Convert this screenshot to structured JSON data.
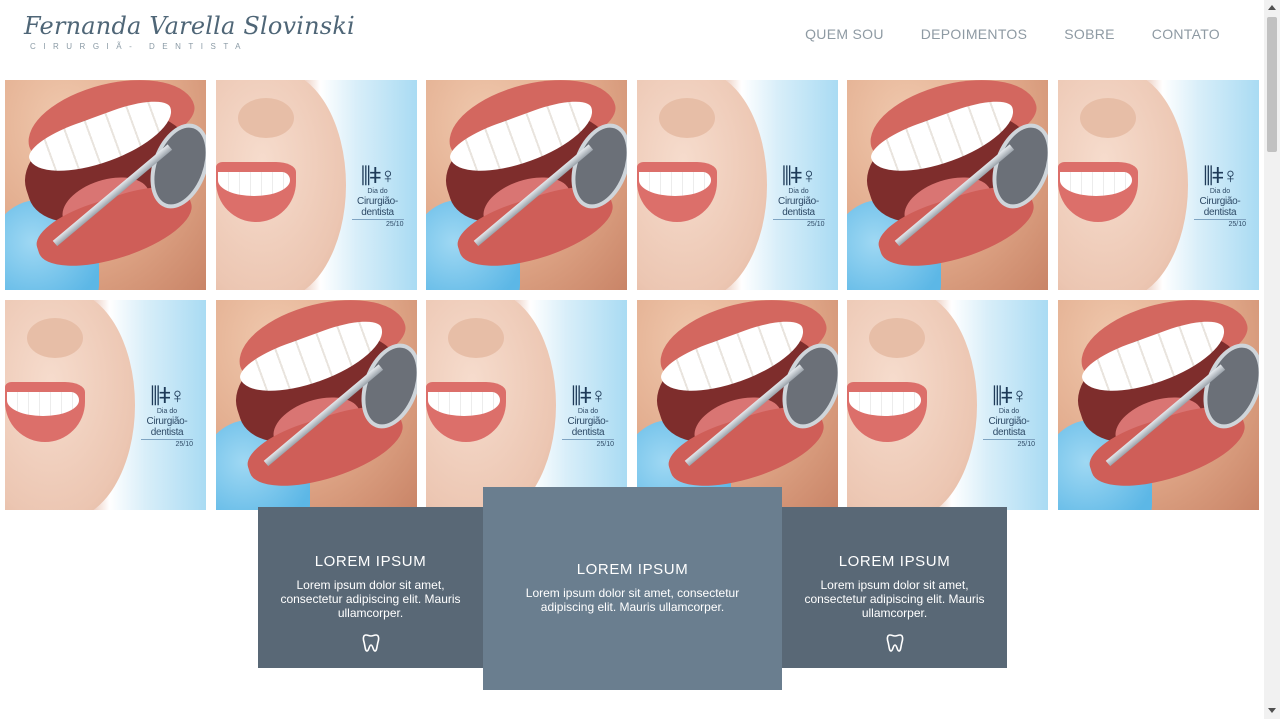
{
  "header": {
    "logo_name": "Fernanda Varella Slovinski",
    "logo_subtitle": "CIRURGIÃ- DENTISTA",
    "nav": [
      "QUEM SOU",
      "DEPOIMENTOS",
      "SOBRE",
      "CONTATO"
    ]
  },
  "gallery": {
    "badge": {
      "small": "Dia do",
      "main": "Cirurgião-dentista",
      "date": "25/10"
    },
    "rows": [
      [
        "mirror",
        "blue",
        "mirror",
        "blue",
        "mirror",
        "blue"
      ],
      [
        "blue",
        "mirror",
        "blue",
        "mirror",
        "blue",
        "mirror"
      ]
    ]
  },
  "cards": [
    {
      "title": "LOREM IPSUM",
      "text": "Lorem ipsum dolor sit amet, consectetur adipiscing elit. Mauris ullamcorper.",
      "icon": "tooth-icon"
    },
    {
      "title": "LOREM IPSUM",
      "text": "Lorem ipsum dolor sit amet, consectetur adipiscing elit. Mauris ullamcorper."
    },
    {
      "title": "LOREM IPSUM",
      "text": "Lorem ipsum dolor sit amet, consectetur adipiscing elit. Mauris ullamcorper.",
      "icon": "tooth-icon"
    }
  ],
  "colors": {
    "card_side": "#596876",
    "card_center": "#6a7e8f",
    "nav_text": "#8e9aa3",
    "logo_text": "#4f6677"
  }
}
